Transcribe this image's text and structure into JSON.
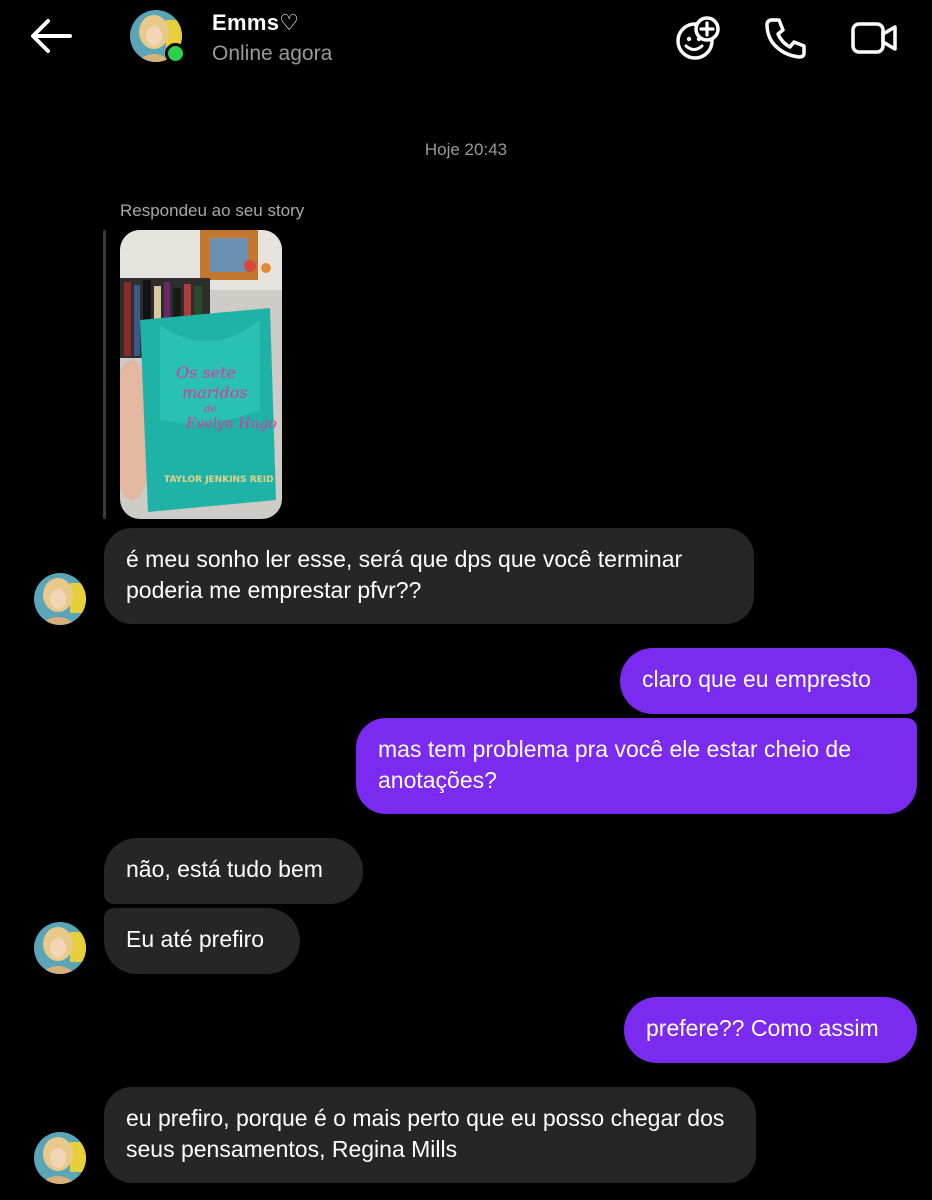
{
  "header": {
    "back_icon": "arrow-left-icon",
    "name": "Emms♡",
    "status": "Online agora",
    "online_color": "#2ad04f",
    "actions": [
      "add-sticker-icon",
      "phone-icon",
      "video-camera-icon"
    ]
  },
  "timestamp": "Hoje 20:43",
  "story_reply": {
    "caption": "Respondeu ao seu story",
    "book_title": "Os sete maridos de Evelyn Hugo",
    "book_author": "TAYLOR JENKINS REID"
  },
  "messages": [
    {
      "from": "them",
      "text": "é meu sonho ler esse, será que dps que você terminar poderia me emprestar pfvr??"
    },
    {
      "from": "me",
      "text": "claro que eu empresto"
    },
    {
      "from": "me",
      "text": "mas tem problema pra você ele estar cheio de anotações?"
    },
    {
      "from": "them",
      "text": "não, está tudo bem"
    },
    {
      "from": "them",
      "text": "Eu até prefiro"
    },
    {
      "from": "me",
      "text": "prefere?? Como assim"
    },
    {
      "from": "them",
      "text": "eu prefiro, porque é o mais perto que eu posso chegar dos seus pensamentos, Regina Mills"
    }
  ],
  "colors": {
    "background": "#000000",
    "incoming_bubble": "#262626",
    "outgoing_bubble": "#7b2af0",
    "muted_text": "#9a9a9a"
  }
}
